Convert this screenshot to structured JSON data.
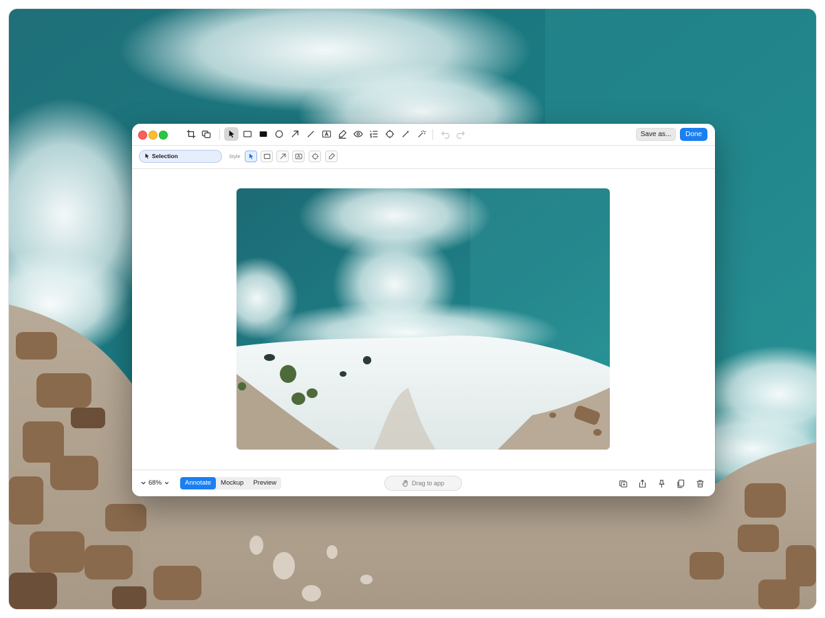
{
  "toolbar": {
    "tools": [
      "crop-icon",
      "duplicate-icon",
      "pointer-icon",
      "rectangle-icon",
      "filled-rectangle-icon",
      "ellipse-icon",
      "arrow-icon",
      "line-icon",
      "text-icon",
      "highlighter-icon",
      "blur-eye-icon",
      "counter-list-icon",
      "spotlight-icon",
      "pencil-icon",
      "magic-wand-icon",
      "undo-icon",
      "redo-icon"
    ],
    "save_as_label": "Save as...",
    "done_label": "Done"
  },
  "stylebar": {
    "selection_label": "Selection",
    "style_label": "Style"
  },
  "bottombar": {
    "zoom_label": "68%",
    "modes": [
      "Annotate",
      "Mockup",
      "Preview"
    ],
    "active_mode": "Annotate",
    "drag_label": "Drag to app",
    "actions": [
      "add-to-clipboard-icon",
      "share-icon",
      "pin-icon",
      "copy-icon",
      "trash-icon"
    ]
  },
  "colors": {
    "accent": "#1a7ff2",
    "close": "#fe5f57",
    "minimize": "#febc2e",
    "maximize": "#28c840"
  }
}
